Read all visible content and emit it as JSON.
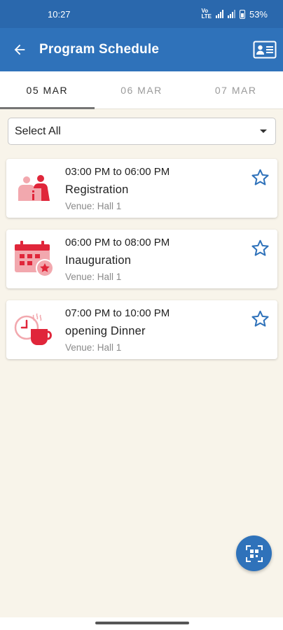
{
  "status_bar": {
    "time": "10:27",
    "battery": "53%",
    "network": "Vo LTE"
  },
  "app_bar": {
    "title": "Program Schedule",
    "back_icon": "arrow-left-icon",
    "action_icon": "id-card-icon"
  },
  "tabs": [
    {
      "label": "05 MAR",
      "active": true
    },
    {
      "label": "06 MAR",
      "active": false
    },
    {
      "label": "07 MAR",
      "active": false
    }
  ],
  "filter": {
    "selected": "Select All"
  },
  "events": [
    {
      "time": "03:00 PM to 06:00 PM",
      "name": "Registration",
      "venue": "Venue: Hall 1",
      "icon": "registration-icon"
    },
    {
      "time": "06:00 PM to 08:00 PM",
      "name": "Inauguration",
      "venue": "Venue: Hall 1",
      "icon": "calendar-star-icon"
    },
    {
      "time": "07:00 PM to 10:00 PM",
      "name": "opening Dinner",
      "venue": "Venue: Hall 1",
      "icon": "clock-cup-icon"
    }
  ],
  "fab": {
    "icon": "qr-scan-icon"
  },
  "colors": {
    "primary": "#2f72ba",
    "status_bar": "#2a68ad",
    "accent_red": "#e0263a",
    "background": "#f8f4ea"
  }
}
